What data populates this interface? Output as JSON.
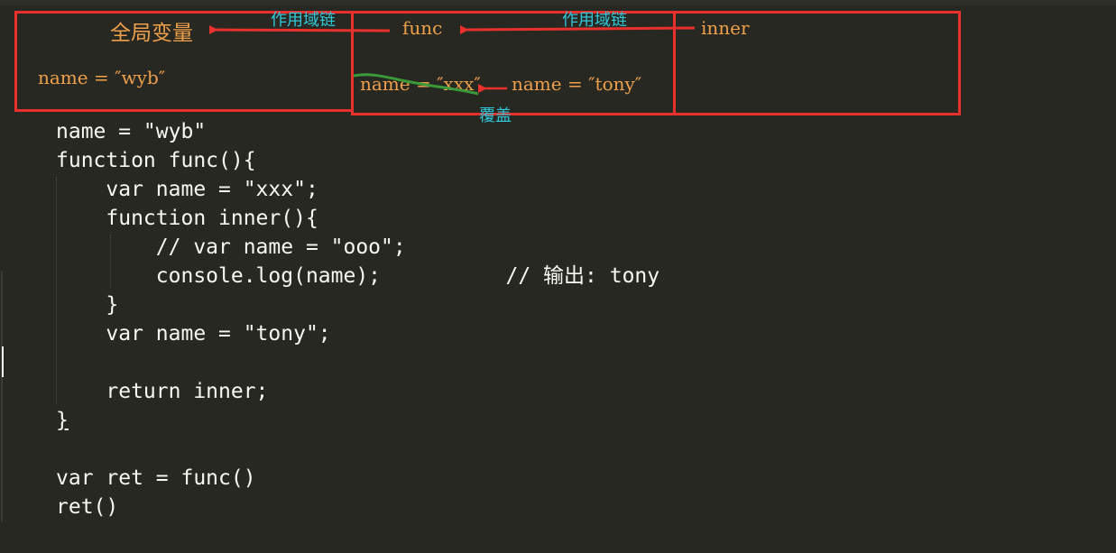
{
  "diagram": {
    "global_label": "全局变量",
    "global_var": "name = ″wyb″",
    "func_label": "func",
    "func_var_xxx": "name = ″xxx″",
    "func_var_tony": "name = ″tony″",
    "inner_label": "inner",
    "scope_chain_1": "作用域链",
    "scope_chain_2": "作用域链",
    "override": "覆盖",
    "box_color": "#e8302c",
    "annotation_color": "#2fc6d8",
    "strike_color": "#3a9a3a"
  },
  "code": {
    "lines": [
      "name = \"wyb\"",
      "function func(){",
      "    var name = \"xxx\";",
      "    function inner(){",
      "        // var name = \"ooo\";",
      "        console.log(name);          // 输出: tony",
      "    }",
      "    var name = \"tony\";",
      "",
      "    return inner;",
      "}",
      "",
      "var ret = func()",
      "ret()"
    ],
    "text_color": "#f8f8f2",
    "background": "#272822"
  }
}
